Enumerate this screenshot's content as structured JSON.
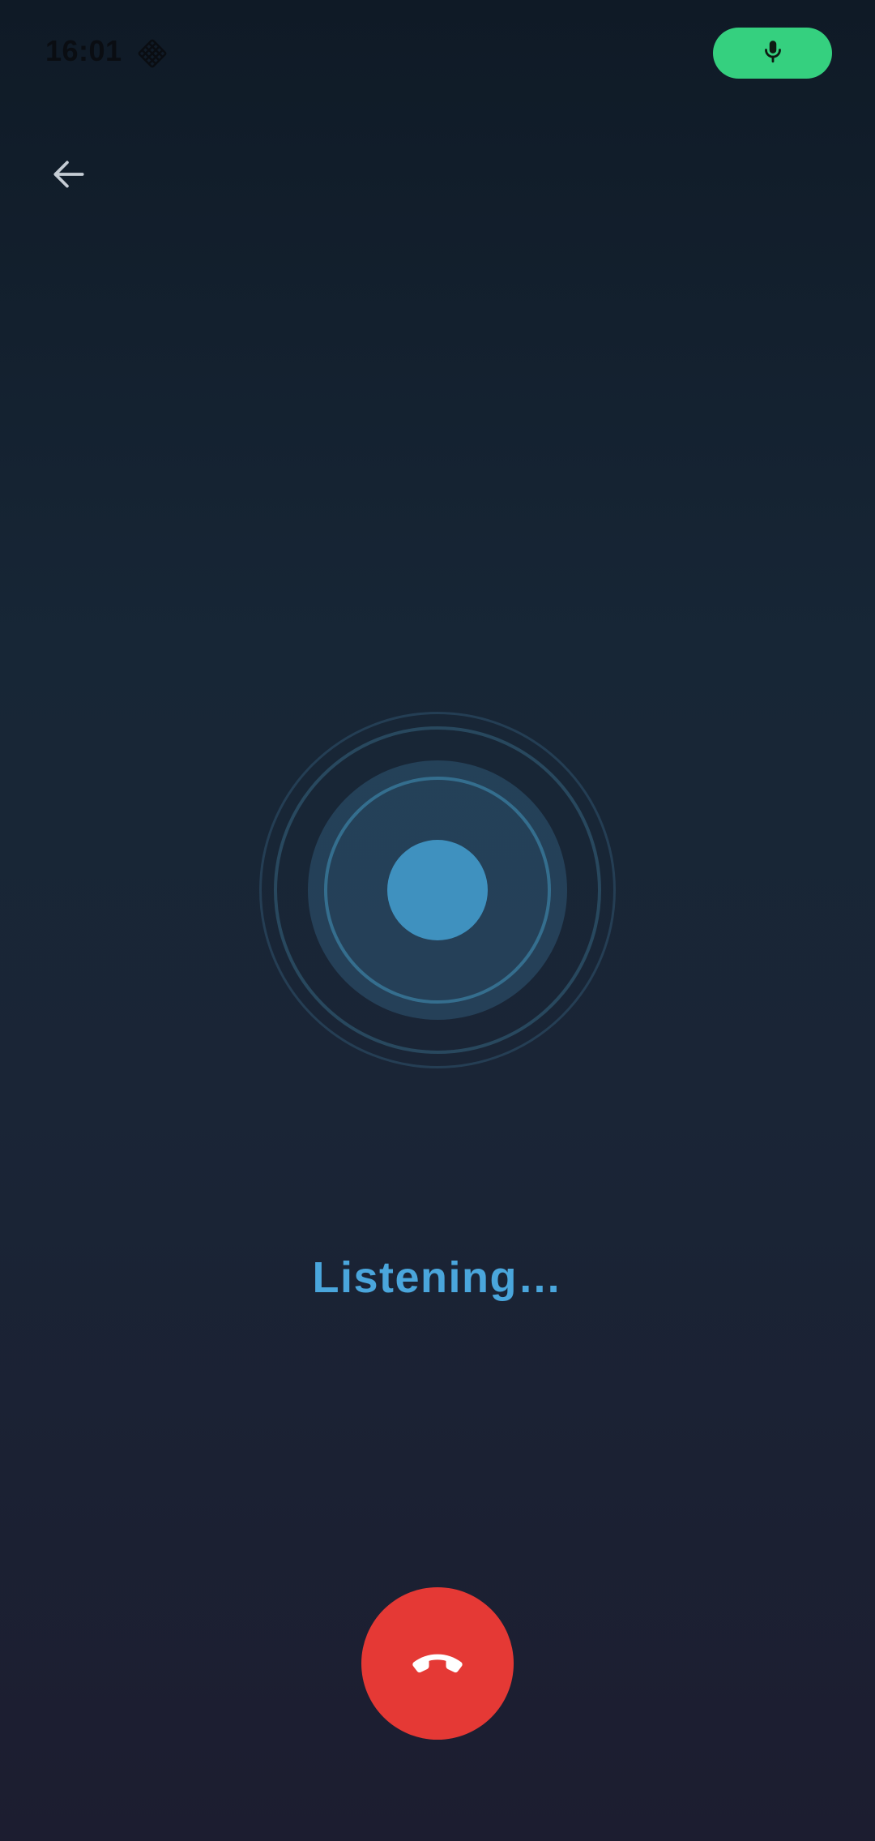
{
  "status_bar": {
    "time": "16:01",
    "left_icon": "diamond-grid-icon",
    "right_indicator_icon": "microphone-icon",
    "right_indicator_color": "#35d07f"
  },
  "nav": {
    "back_icon": "arrow-left-icon"
  },
  "visualizer": {
    "accent_color": "#3f91bf"
  },
  "main": {
    "status_text": "Listening…",
    "status_color": "#4aa6dc"
  },
  "call_controls": {
    "end_call_icon": "phone-hangup-icon",
    "end_call_color": "#e53935"
  }
}
